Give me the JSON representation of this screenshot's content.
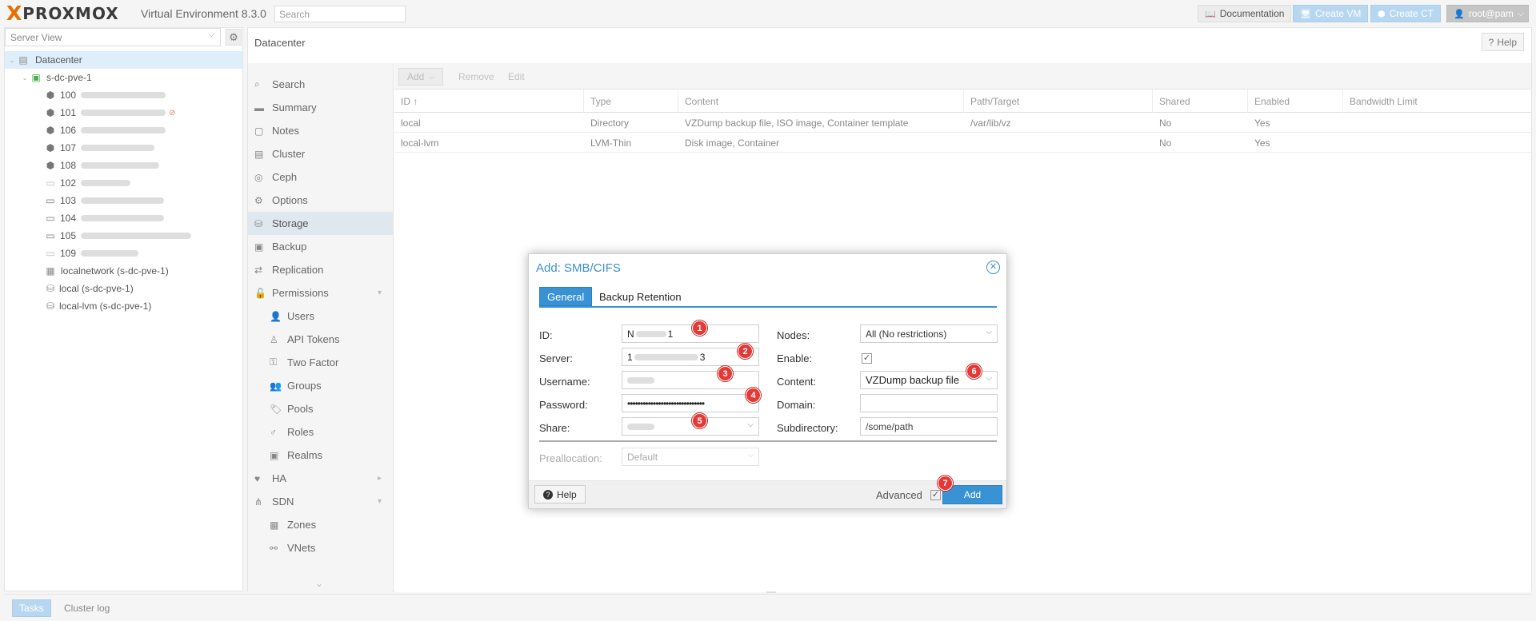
{
  "header": {
    "logo_x": "X",
    "logo_text": "PROXMOX",
    "version": "Virtual Environment 8.3.0",
    "search_placeholder": "Search",
    "docs_label": "Documentation",
    "create_vm_label": "Create VM",
    "create_ct_label": "Create CT",
    "user_label": "root@pam"
  },
  "tree": {
    "view_select": "Server View",
    "datacenter": "Datacenter",
    "node": "s-dc-pve-1",
    "guests": [
      {
        "id": "100",
        "status": "running-ct"
      },
      {
        "id": "101",
        "status": "running-ct"
      },
      {
        "id": "106",
        "status": "running-ct"
      },
      {
        "id": "107",
        "status": "running-ct"
      },
      {
        "id": "108",
        "status": "running-ct"
      },
      {
        "id": "102",
        "status": "stopped-vm"
      },
      {
        "id": "103",
        "status": "running-vm"
      },
      {
        "id": "104",
        "status": "running-vm"
      },
      {
        "id": "105",
        "status": "running-vm"
      },
      {
        "id": "109",
        "status": "stopped-vm"
      }
    ],
    "sdn": "localnetwork (s-dc-pve-1)",
    "storages": [
      "local (s-dc-pve-1)",
      "local-lvm (s-dc-pve-1)"
    ]
  },
  "content": {
    "title": "Datacenter",
    "help_label": "Help",
    "menu": [
      {
        "label": "Search",
        "icon": "search-icon"
      },
      {
        "label": "Summary",
        "icon": "book-icon"
      },
      {
        "label": "Notes",
        "icon": "note-icon"
      },
      {
        "label": "Cluster",
        "icon": "server-icon"
      },
      {
        "label": "Ceph",
        "icon": "ceph-icon"
      },
      {
        "label": "Options",
        "icon": "gear-icon"
      },
      {
        "label": "Storage",
        "icon": "database-icon"
      },
      {
        "label": "Backup",
        "icon": "floppy-icon"
      },
      {
        "label": "Replication",
        "icon": "retweet-icon"
      },
      {
        "label": "Permissions",
        "icon": "unlock-icon"
      },
      {
        "label": "Users",
        "icon": "user-icon"
      },
      {
        "label": "API Tokens",
        "icon": "user-o-icon"
      },
      {
        "label": "Two Factor",
        "icon": "key-icon"
      },
      {
        "label": "Groups",
        "icon": "users-icon"
      },
      {
        "label": "Pools",
        "icon": "tags-icon"
      },
      {
        "label": "Roles",
        "icon": "male-icon"
      },
      {
        "label": "Realms",
        "icon": "address-book-icon"
      },
      {
        "label": "HA",
        "icon": "heartbeat-icon"
      },
      {
        "label": "SDN",
        "icon": "sitemap-icon"
      },
      {
        "label": "Zones",
        "icon": "th-icon"
      },
      {
        "label": "VNets",
        "icon": "network-icon"
      }
    ],
    "toolbar": {
      "add": "Add",
      "remove": "Remove",
      "edit": "Edit"
    },
    "columns": [
      "ID ↑",
      "Type",
      "Content",
      "Path/Target",
      "Shared",
      "Enabled",
      "Bandwidth Limit"
    ],
    "rows": [
      [
        "local",
        "Directory",
        "VZDump backup file, ISO image, Container template",
        "/var/lib/vz",
        "No",
        "Yes",
        ""
      ],
      [
        "local-lvm",
        "LVM-Thin",
        "Disk image, Container",
        "",
        "No",
        "Yes",
        ""
      ]
    ]
  },
  "dialog": {
    "title": "Add: SMB/CIFS",
    "tabs": [
      "General",
      "Backup Retention"
    ],
    "left": {
      "id_label": "ID:",
      "id_value": "N",
      "id_value_end": "1",
      "server_label": "Server:",
      "server_value": "1",
      "server_value_end": "3",
      "username_label": "Username:",
      "password_label": "Password:",
      "password_value": "••••••••••••••••••••••••••••••",
      "share_label": "Share:"
    },
    "right": {
      "nodes_label": "Nodes:",
      "nodes_value": "All (No restrictions)",
      "enable_label": "Enable:",
      "content_label": "Content:",
      "content_value": "VZDump backup file",
      "domain_label": "Domain:",
      "domain_value": "",
      "subdir_label": "Subdirectory:",
      "subdir_value": "/some/path"
    },
    "prealloc_label": "Preallocation:",
    "prealloc_value": "Default",
    "help_label": "Help",
    "advanced_label": "Advanced",
    "add_label": "Add",
    "badges": [
      "1",
      "2",
      "3",
      "4",
      "5",
      "6",
      "7"
    ]
  },
  "bottom": {
    "tasks": "Tasks",
    "cluster_log": "Cluster log"
  },
  "colors": {
    "accent": "#3892d4",
    "badge": "#e53935",
    "logo_orange": "#e57000"
  }
}
